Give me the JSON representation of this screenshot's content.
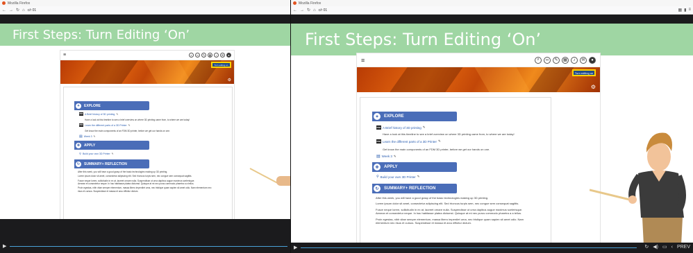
{
  "browser": {
    "title": "Mozilla Firefox",
    "url": "c/r 01"
  },
  "slide": {
    "banner_title": "First Steps: Turn Editing ‘On’"
  },
  "moodle": {
    "edit_button": "Turn editing on",
    "sections": [
      {
        "name": "EXPLORE",
        "icon": "compass-icon",
        "items": [
          {
            "type": "pdf",
            "title": "A Brief history of 3D printing",
            "desc": "Have a look at this timeline to see a brief overview on where 3D printing came from, to where we are today!"
          },
          {
            "type": "pdf",
            "title": "Learn the different parts of a 3D Printer",
            "desc": "Get know the main components of an FDM 3D printer, before we get our hands on one."
          },
          {
            "type": "page",
            "title": "Week 3",
            "desc": ""
          }
        ]
      },
      {
        "name": "APPLY",
        "icon": "wrench-icon",
        "items": [
          {
            "type": "link",
            "title": "Build your own 3D Printer",
            "desc": ""
          }
        ]
      },
      {
        "name": "SUMMARY+ REFLECTION",
        "icon": "rotate-icon",
        "paragraphs": [
          "After this week, you will have a good grasp of the basic technologies making up 3D printing.",
          "Lorem ipsum dolor sit amet, consectetur adipiscing elit. Sed rhoncus turpis sem, nec congue sem consequat sagittis.",
          "Fusce neque lorem, sollicitudin in ex at, laoreet ornare nulla. Suspendisse ut urna dapibus augue maximus scelerisque.",
          "Aenean et consectetur neque. In hac habitasse platea dictumst. Quisque at mi nec purus commodo pharetra a a tellus.",
          "Proin egestas, nibh vitae semper elementum, massa libero imperdiet urna, nec tristique quam sapien sit amet odio. Nam elementum nec risus et cursus. Suspendisse et massa et arcu efficitur dictum."
        ]
      }
    ]
  },
  "player": {
    "prev_label": "PREV"
  },
  "colors": {
    "banner": "#9fd6a3",
    "section": "#4a6db8",
    "progress": "#4aa3d9"
  }
}
